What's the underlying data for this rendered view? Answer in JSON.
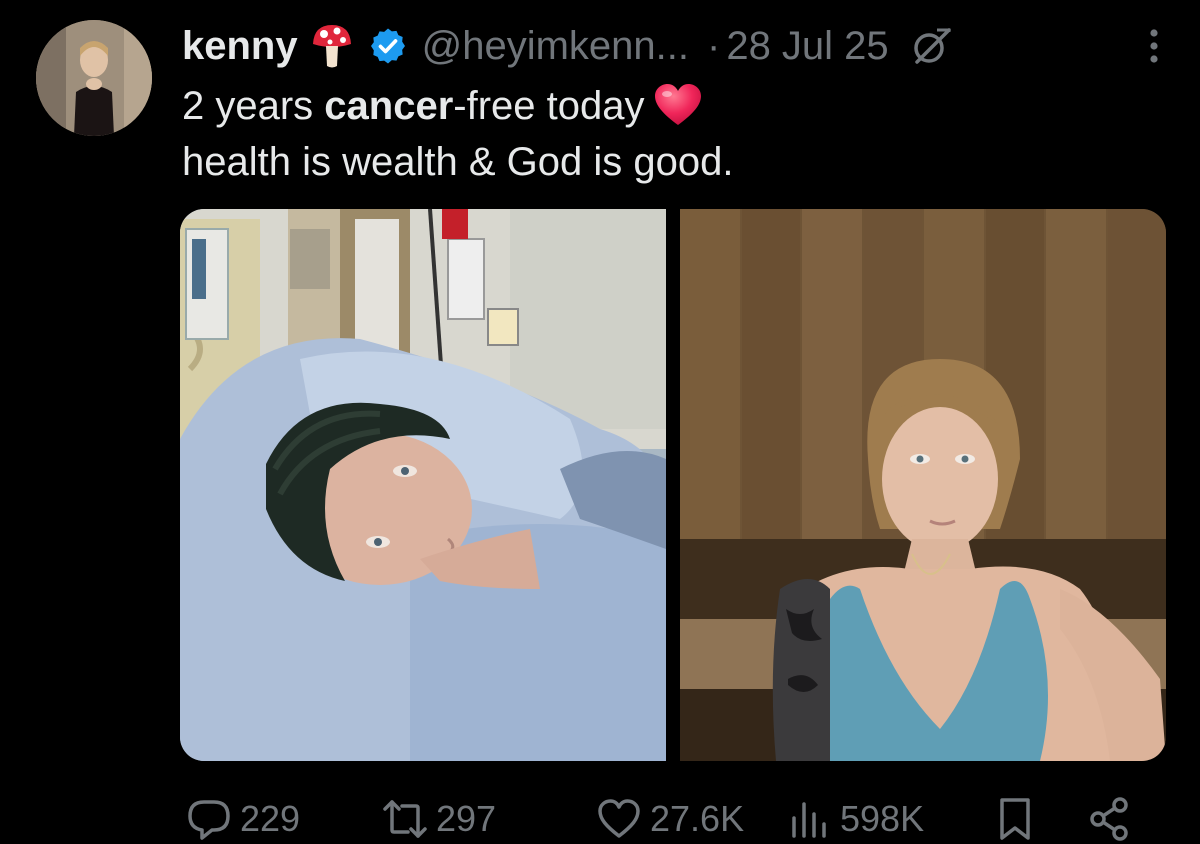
{
  "author": {
    "display_name": "kenny",
    "name_emoji": "mushroom-emoji",
    "verified": true,
    "handle": "@heyimkenn...",
    "separator": "·",
    "date": "28 Jul 25"
  },
  "tweet": {
    "line1_prefix": "2 years ",
    "line1_bold": "cancer",
    "line1_suffix": "-free today",
    "line1_emoji": "red-heart-emoji",
    "line2": "health is wealth & God is good."
  },
  "media": {
    "left_photo": "hospital-bed-selfie",
    "right_photo": "sauna-selfie"
  },
  "actions": {
    "replies": "229",
    "reposts": "297",
    "likes": "27.6K",
    "views": "598K"
  },
  "colors": {
    "background": "#000000",
    "text_primary": "#e7e9ea",
    "text_secondary": "#71767b",
    "verified_blue": "#1d9bf0",
    "heart_red": "#f0265a"
  }
}
